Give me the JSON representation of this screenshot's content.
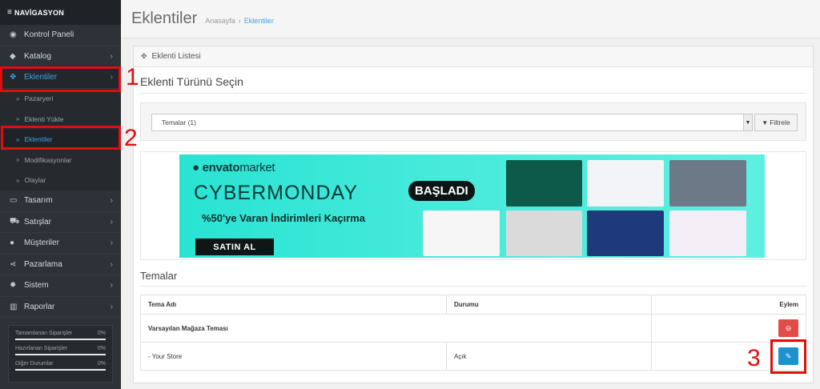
{
  "sidebar": {
    "header": "NAVİGASYON",
    "items": [
      {
        "label": "Kontrol Paneli",
        "icon": "dashboard-icon",
        "glyph": "◉",
        "chevron": ""
      },
      {
        "label": "Katalog",
        "icon": "tag-icon",
        "glyph": "◆",
        "chevron": "›"
      },
      {
        "label": "Eklentiler",
        "icon": "puzzle-icon",
        "glyph": "✥",
        "chevron": "›"
      }
    ],
    "submenu": [
      "Pazaryeri",
      "Eklenti Yükle",
      "Eklentiler",
      "Modifikasyonlar",
      "Olaylar"
    ],
    "items2": [
      {
        "label": "Tasarım",
        "icon": "monitor-icon",
        "glyph": "▭",
        "chevron": "›"
      },
      {
        "label": "Satışlar",
        "icon": "cart-icon",
        "glyph": "⛟",
        "chevron": "›"
      },
      {
        "label": "Müşteriler",
        "icon": "user-icon",
        "glyph": "●",
        "chevron": "›"
      },
      {
        "label": "Pazarlama",
        "icon": "share-icon",
        "glyph": "⋖",
        "chevron": "›"
      },
      {
        "label": "Sistem",
        "icon": "cog-icon",
        "glyph": "✹",
        "chevron": "›"
      },
      {
        "label": "Raporlar",
        "icon": "bar-chart-icon",
        "glyph": "▥",
        "chevron": "›"
      }
    ],
    "stats": [
      {
        "label": "Tamamlanan Siparişler",
        "value": "0%"
      },
      {
        "label": "Hazırlanan Siparişler",
        "value": "0%"
      },
      {
        "label": "Diğer Durumlar",
        "value": "0%"
      }
    ]
  },
  "header": {
    "title": "Eklentiler",
    "breadcrumb_home": "Anasayfa",
    "breadcrumb_sep": "›",
    "breadcrumb_current": "Eklentiler"
  },
  "panel": {
    "heading": "Eklenti Listesi",
    "section_title": "Eklenti Türünü Seçin",
    "select_value": "Temalar (1)",
    "filter_label": "Filtrele"
  },
  "banner": {
    "brand": "envato",
    "brand_suffix": "market",
    "headline": "CYBERMONDAY",
    "badge": "BAŞLADI",
    "promo_text": "%50'ye Varan İndirimleri Kaçırma",
    "cta": "SATIN AL"
  },
  "themes": {
    "title": "Temalar",
    "columns": [
      "Tema Adı",
      "Durumu",
      "Eylem"
    ],
    "group_name": "Varsayılan Mağaza Teması",
    "rows": [
      {
        "name": "-  Your Store",
        "status": "Açık"
      }
    ]
  },
  "annotations": [
    "1",
    "2",
    "3"
  ],
  "colors": {
    "accent": "#3aa3e3",
    "highlight": "#e10d0d",
    "danger": "#e14c48",
    "primary": "#1e91cf"
  }
}
